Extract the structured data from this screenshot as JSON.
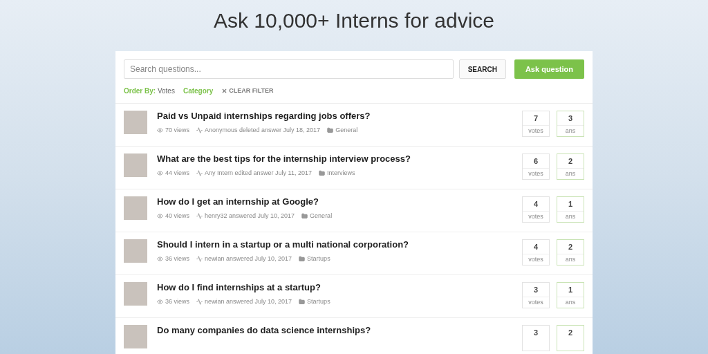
{
  "heading": "Ask 10,000+ Interns for advice",
  "search": {
    "placeholder": "Search questions...",
    "button": "SEARCH",
    "ask_button": "Ask question"
  },
  "filters": {
    "order_label": "Order By:",
    "order_value": "Votes",
    "category": "Category",
    "clear": "CLEAR FILTER"
  },
  "questions": [
    {
      "title": "Paid vs Unpaid internships regarding jobs offers?",
      "views": "70 views",
      "activity": "Anonymous deleted answer July 18, 2017",
      "category": "General",
      "votes": "7",
      "votes_label": "votes",
      "answers": "3",
      "answers_label": "ans"
    },
    {
      "title": "What are the best tips for the internship interview process?",
      "views": "44 views",
      "activity": "Any Intern edited answer July 11, 2017",
      "category": "Interviews",
      "votes": "6",
      "votes_label": "votes",
      "answers": "2",
      "answers_label": "ans"
    },
    {
      "title": "How do I get an internship at Google?",
      "views": "40 views",
      "activity": "henry32 answered July 10, 2017",
      "category": "General",
      "votes": "4",
      "votes_label": "votes",
      "answers": "1",
      "answers_label": "ans"
    },
    {
      "title": "Should I intern in a startup or a multi national corporation?",
      "views": "36 views",
      "activity": "newian answered July 10, 2017",
      "category": "Startups",
      "votes": "4",
      "votes_label": "votes",
      "answers": "2",
      "answers_label": "ans"
    },
    {
      "title": "How do I find internships at a startup?",
      "views": "36 views",
      "activity": "newian answered July 10, 2017",
      "category": "Startups",
      "votes": "3",
      "votes_label": "votes",
      "answers": "1",
      "answers_label": "ans"
    },
    {
      "title": "Do many companies do data science internships?",
      "votes": "3",
      "answers": "2"
    }
  ]
}
